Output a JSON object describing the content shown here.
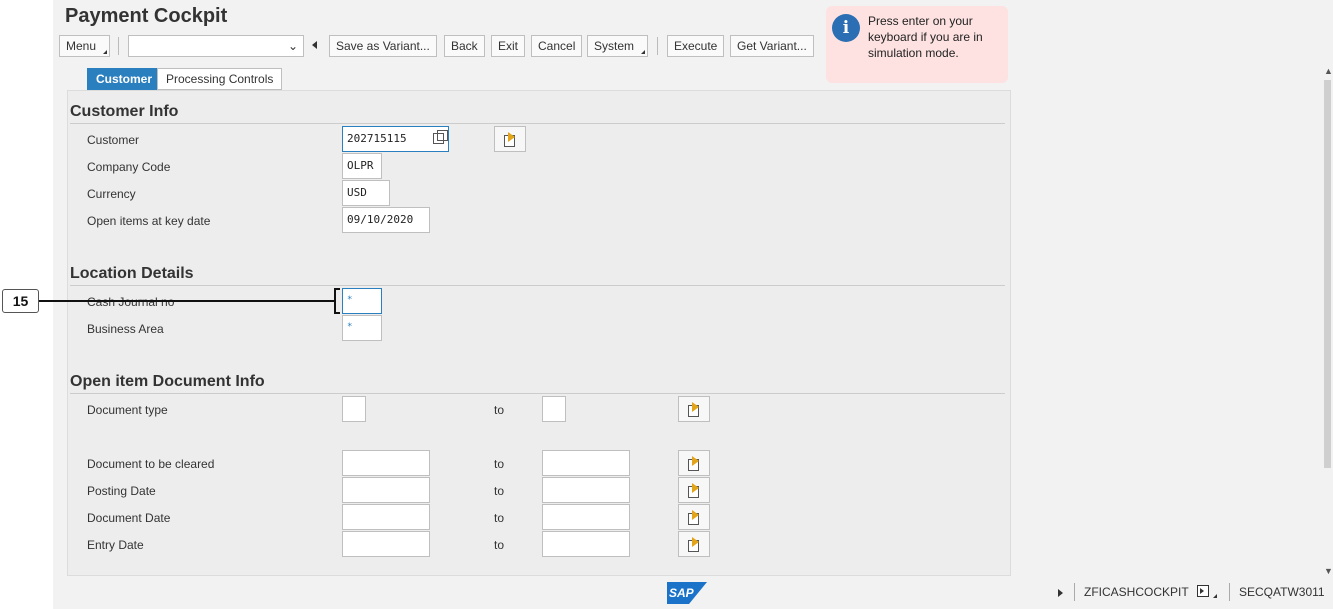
{
  "app": {
    "title": "Payment Cockpit"
  },
  "toolbar": {
    "menu_label": "Menu",
    "variant_select_value": "",
    "save_as_variant_label": "Save as Variant...",
    "back_label": "Back",
    "exit_label": "Exit",
    "cancel_label": "Cancel",
    "system_label": "System",
    "execute_label": "Execute",
    "get_variant_label": "Get Variant..."
  },
  "tooltip": {
    "message": "Press enter on your keyboard if you are in simulation mode."
  },
  "tabs": [
    {
      "label": "Customer",
      "active": true
    },
    {
      "label": "Processing Controls",
      "active": false
    }
  ],
  "customer_info": {
    "heading": "Customer Info",
    "customer_label": "Customer",
    "customer_value": "202715115",
    "company_code_label": "Company Code",
    "company_code_value": "OLPR",
    "currency_label": "Currency",
    "currency_value": "USD",
    "key_date_label": "Open items at key date",
    "key_date_value": "09/10/2020"
  },
  "location_details": {
    "heading": "Location Details",
    "cash_journal_label": "Cash Journal  no",
    "cash_journal_value": "*",
    "business_area_label": "Business Area",
    "business_area_value": "*"
  },
  "document_info": {
    "heading": "Open item Document Info",
    "to_label": "to",
    "rows": [
      {
        "label": "Document type",
        "from": "",
        "to": ""
      },
      {
        "label": "Document to be cleared",
        "from": "",
        "to": ""
      },
      {
        "label": "Posting Date",
        "from": "",
        "to": ""
      },
      {
        "label": "Document Date",
        "from": "",
        "to": ""
      },
      {
        "label": "Entry Date",
        "from": "",
        "to": ""
      }
    ]
  },
  "callout": {
    "number": "15"
  },
  "status_bar": {
    "logo": "SAP",
    "transaction": "ZFICASHCOCKPIT",
    "system": "SECQATW3011"
  },
  "colors": {
    "accent": "#2a7fbf",
    "tooltip_bg": "#fde2e1",
    "info_icon": "#2b6eb3",
    "multi_arrow": "#e3a41a"
  }
}
